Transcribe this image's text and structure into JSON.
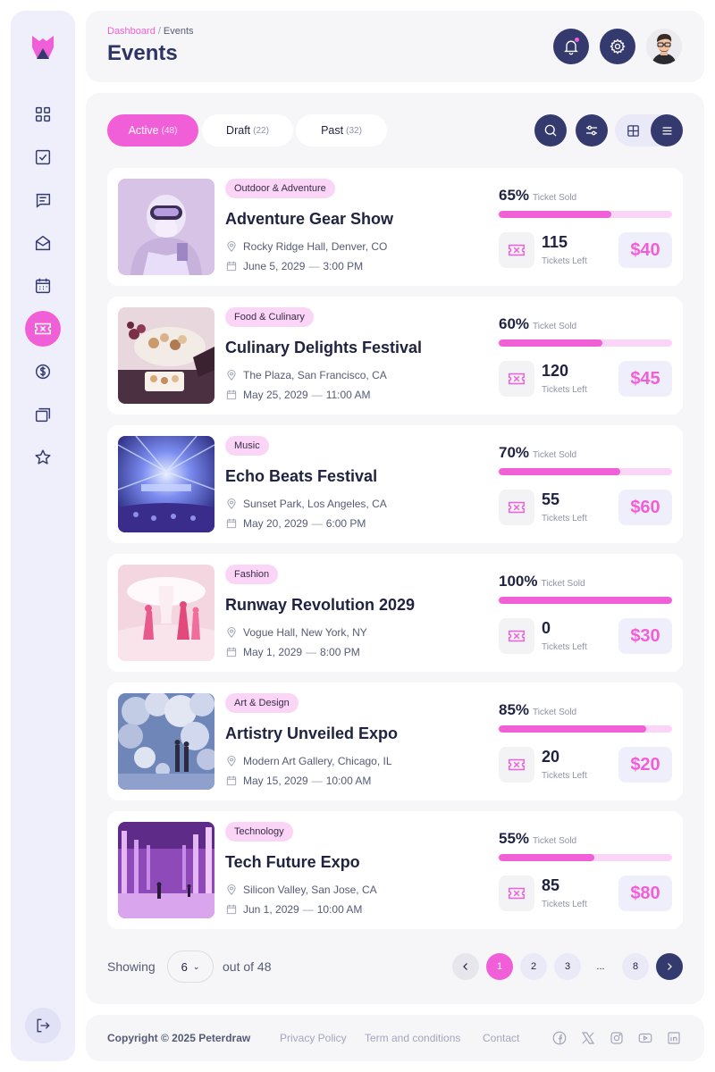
{
  "header": {
    "breadcrumb": {
      "root": "Dashboard",
      "separator": "/",
      "current": "Events"
    },
    "title": "Events"
  },
  "sidebar": {
    "items": [
      {
        "icon": "dashboard-icon"
      },
      {
        "icon": "tasks-icon"
      },
      {
        "icon": "messages-icon"
      },
      {
        "icon": "mail-icon"
      },
      {
        "icon": "calendar-icon"
      },
      {
        "icon": "ticket-icon",
        "active": true
      },
      {
        "icon": "dollar-icon"
      },
      {
        "icon": "gallery-icon"
      },
      {
        "icon": "star-icon"
      }
    ],
    "logout_icon": "logout-icon"
  },
  "tabs": [
    {
      "label": "Active",
      "count": "(48)",
      "active": true
    },
    {
      "label": "Draft",
      "count": "(22)",
      "active": false
    },
    {
      "label": "Past",
      "count": "(32)",
      "active": false
    }
  ],
  "events": [
    {
      "category": "Outdoor & Adventure",
      "title": "Adventure Gear Show",
      "location": "Rocky Ridge Hall, Denver, CO",
      "date": "June 5, 2029",
      "time": "3:00 PM",
      "percent_label": "65%",
      "percent": 0.65,
      "sold_label": "Ticket Sold",
      "tickets_left": "115",
      "tickets_left_label": "Tickets Left",
      "price": "$40"
    },
    {
      "category": "Food & Culinary",
      "title": "Culinary Delights Festival",
      "location": "The Plaza, San Francisco, CA",
      "date": "May 25, 2029",
      "time": "11:00 AM",
      "percent_label": "60%",
      "percent": 0.6,
      "sold_label": "Ticket Sold",
      "tickets_left": "120",
      "tickets_left_label": "Tickets Left",
      "price": "$45"
    },
    {
      "category": "Music",
      "title": "Echo Beats Festival",
      "location": "Sunset Park, Los Angeles, CA",
      "date": "May 20, 2029",
      "time": "6:00 PM",
      "percent_label": "70%",
      "percent": 0.7,
      "sold_label": "Ticket Sold",
      "tickets_left": "55",
      "tickets_left_label": "Tickets Left",
      "price": "$60"
    },
    {
      "category": "Fashion",
      "title": "Runway Revolution 2029",
      "location": "Vogue Hall, New York, NY",
      "date": "May 1, 2029",
      "time": "8:00 PM",
      "percent_label": "100%",
      "percent": 1.0,
      "sold_label": "Ticket Sold",
      "tickets_left": "0",
      "tickets_left_label": "Tickets Left",
      "price": "$30"
    },
    {
      "category": "Art & Design",
      "title": "Artistry Unveiled Expo",
      "location": "Modern Art Gallery, Chicago, IL",
      "date": "May 15, 2029",
      "time": "10:00 AM",
      "percent_label": "85%",
      "percent": 0.85,
      "sold_label": "Ticket Sold",
      "tickets_left": "20",
      "tickets_left_label": "Tickets Left",
      "price": "$20"
    },
    {
      "category": "Technology",
      "title": "Tech Future Expo",
      "location": "Silicon Valley, San Jose, CA",
      "date": "Jun 1, 2029",
      "time": "10:00 AM",
      "percent_label": "55%",
      "percent": 0.55,
      "sold_label": "Ticket Sold",
      "tickets_left": "85",
      "tickets_left_label": "Tickets Left",
      "price": "$80"
    }
  ],
  "pagination": {
    "showing_label": "Showing",
    "page_size": "6",
    "out_of_label": "out of 48",
    "pages": [
      "1",
      "2",
      "3",
      "...",
      "8"
    ],
    "current": "1"
  },
  "footer": {
    "copyright": "Copyright © 2025 Peterdraw",
    "links": [
      "Privacy Policy",
      "Term and conditions",
      "Contact"
    ],
    "social_icons": [
      "facebook-icon",
      "x-icon",
      "instagram-icon",
      "youtube-icon",
      "linkedin-icon"
    ]
  },
  "colors": {
    "accent": "#f05fd7",
    "navy": "#353a6e",
    "accent_light": "#fbd5f5",
    "sidebar_bg": "#efeffc"
  }
}
